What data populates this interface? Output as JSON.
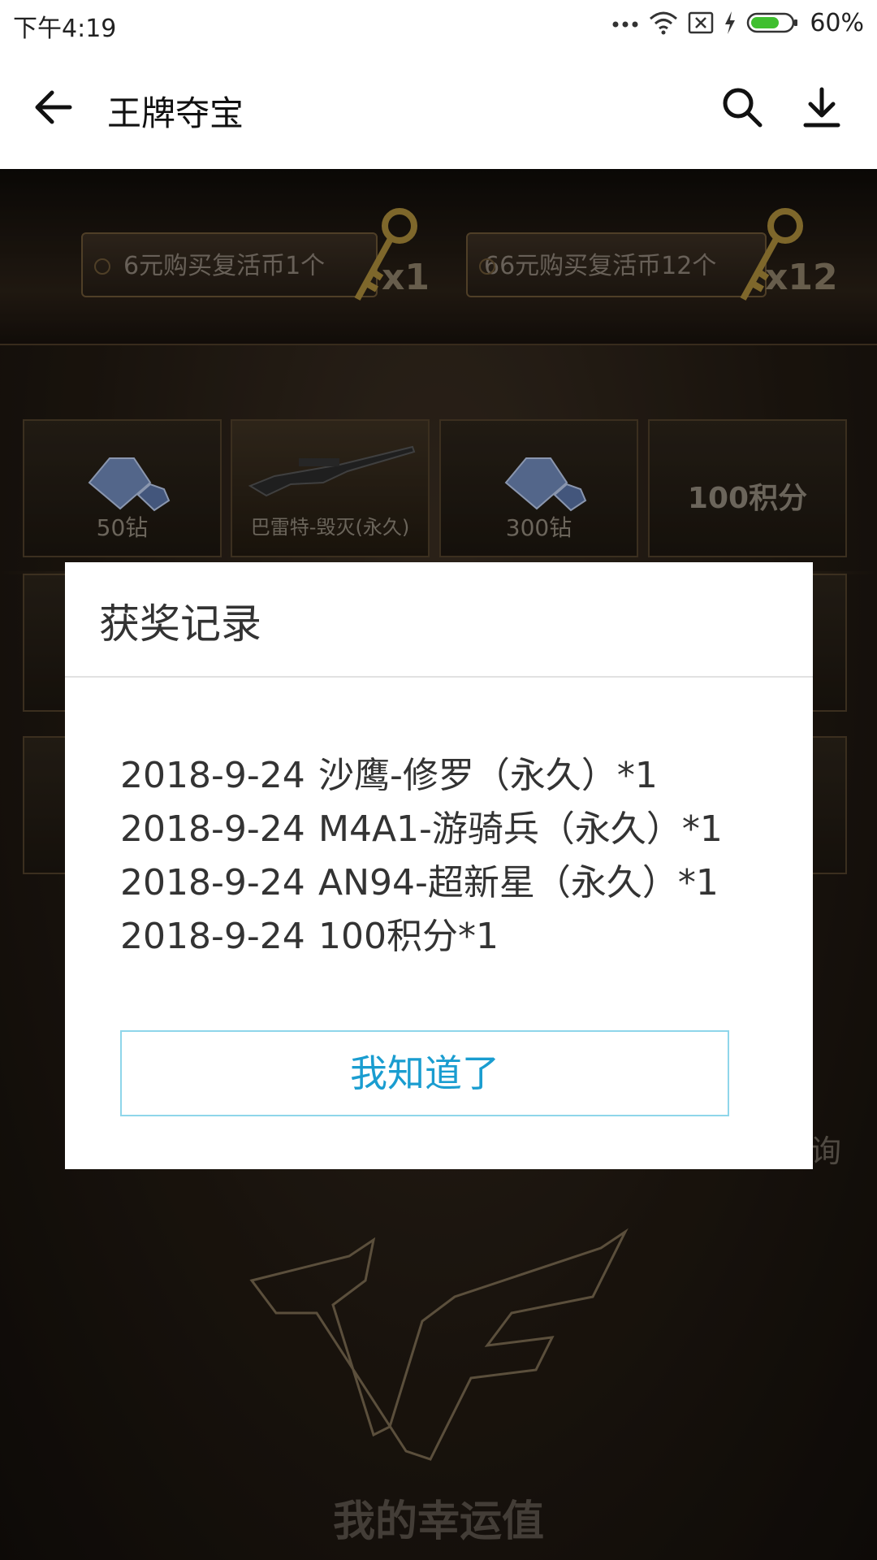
{
  "status_bar": {
    "time": "下午4:19",
    "battery_percent": "60%"
  },
  "header": {
    "title": "王牌夺宝"
  },
  "game": {
    "buy_options": [
      {
        "label": "6元购买复活币1个",
        "multiplier": "x1"
      },
      {
        "label": "66元购买复活币12个",
        "multiplier": "x12"
      }
    ],
    "prizes": [
      {
        "label": "50钻"
      },
      {
        "label": "巴雷特-毁灭(永久)"
      },
      {
        "label": "300钻"
      },
      {
        "label": "100积分"
      }
    ],
    "side_text": "询",
    "lucky_label": "我的幸运值"
  },
  "dialog": {
    "title": "获奖记录",
    "records": [
      {
        "date": "2018-9-24",
        "item": "沙鹰-修罗（永久）*1"
      },
      {
        "date": "2018-9-24",
        "item": "M4A1-游骑兵（永久）*1"
      },
      {
        "date": "2018-9-24",
        "item": "AN94-超新星（永久）*1"
      },
      {
        "date": "2018-9-24",
        "item": "100积分*1"
      }
    ],
    "confirm_label": "我知道了"
  },
  "colors": {
    "accent": "#1a9dd0",
    "button_border": "#8fd6ea",
    "battery_green": "#3fbf2f"
  }
}
